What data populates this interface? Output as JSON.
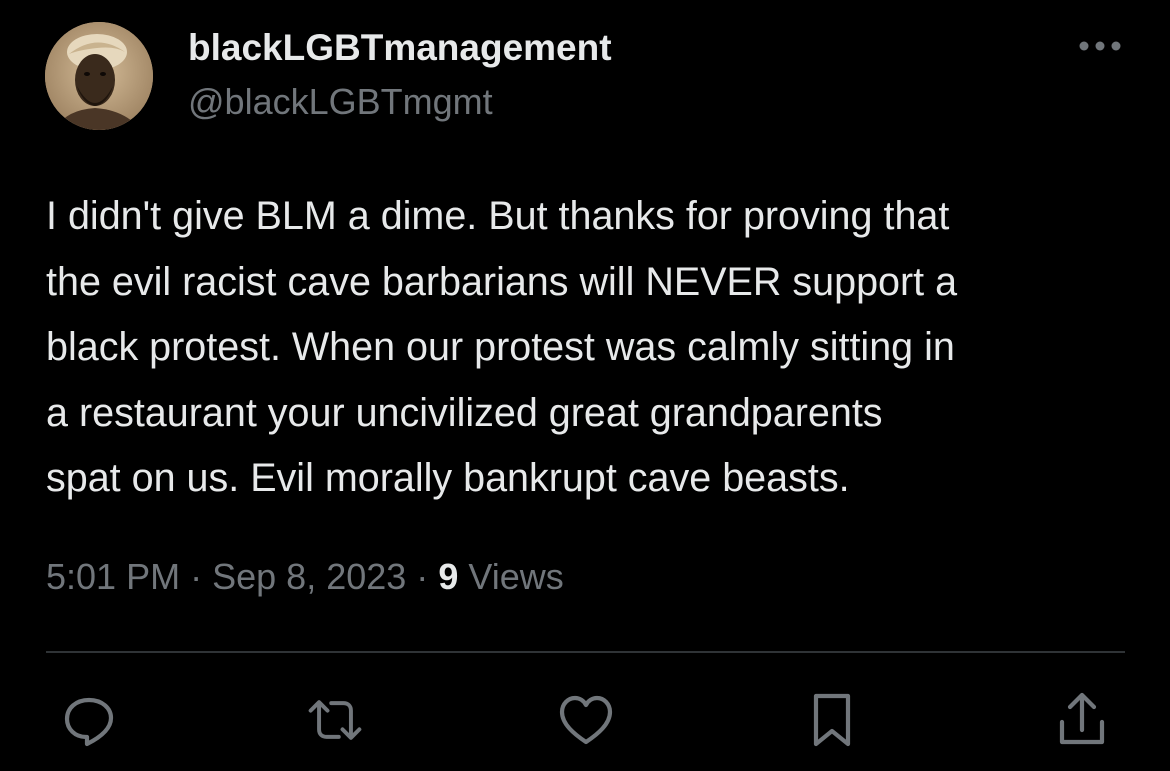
{
  "tweet": {
    "display_name": "blackLGBTmanagement",
    "handle": "@blackLGBTmgmt",
    "avatar_icon": "profile-photo",
    "more_icon": "ellipsis-icon",
    "text_lines": [
      "I didn't give BLM a dime. But thanks for proving that",
      "the evil racist cave barbarians will NEVER support a",
      "black protest. When our protest was calmly sitting in",
      "a restaurant your uncivilized great grandparents",
      "spat on us. Evil morally bankrupt cave beasts."
    ],
    "time": "5:01 PM",
    "separator": "·",
    "date": "Sep 8, 2023",
    "views_count": "9",
    "views_label": "Views"
  },
  "actions": [
    {
      "name": "reply",
      "icon": "reply-icon"
    },
    {
      "name": "retweet",
      "icon": "retweet-icon"
    },
    {
      "name": "like",
      "icon": "heart-icon"
    },
    {
      "name": "bookmark",
      "icon": "bookmark-icon"
    },
    {
      "name": "share",
      "icon": "share-icon"
    }
  ],
  "colors": {
    "background": "#000000",
    "primary_text": "#e7e9ea",
    "secondary_text": "#71767b",
    "divider": "#2f3336"
  }
}
